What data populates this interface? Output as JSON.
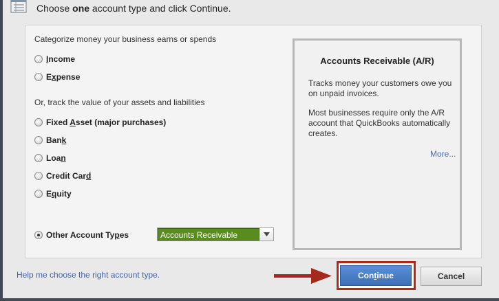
{
  "header": {
    "icon": "account-list-icon",
    "text_before": "Choose ",
    "text_bold": "one",
    "text_after": " account type and click Continue."
  },
  "categorize": {
    "label": "Categorize money your business earns or spends",
    "options": [
      {
        "pre": "",
        "u": "I",
        "post": "ncome",
        "checked": false
      },
      {
        "pre": "E",
        "u": "x",
        "post": "pense",
        "checked": false
      }
    ]
  },
  "track": {
    "label": "Or, track the value of your assets and liabilities",
    "options": [
      {
        "pre": "Fixed ",
        "u": "A",
        "post": "sset (major purchases)",
        "checked": false
      },
      {
        "pre": "Ban",
        "u": "k",
        "post": "",
        "checked": false
      },
      {
        "pre": "Loa",
        "u": "n",
        "post": "",
        "checked": false
      },
      {
        "pre": "Credit Car",
        "u": "d",
        "post": "",
        "checked": false
      },
      {
        "pre": "E",
        "u": "q",
        "post": "uity",
        "checked": false
      }
    ]
  },
  "other": {
    "pre": "Other Account Ty",
    "u": "p",
    "post": "es",
    "checked": true,
    "selected_value": "Accounts Receivable"
  },
  "info": {
    "title": "Accounts Receivable (A/R)",
    "para1": "Tracks money your customers owe you on unpaid invoices.",
    "para2": "Most businesses require only the A/R account that QuickBooks automatically creates.",
    "more": "More..."
  },
  "footer": {
    "help_link": "Help me choose the right account type.",
    "continue_pre": "Con",
    "continue_u": "t",
    "continue_post": "inue",
    "cancel_label": "Cancel"
  },
  "colors": {
    "highlight": "#b02a1c",
    "selected_dropdown": "#5a8b1f",
    "primary_button": "#3c6fb6"
  }
}
